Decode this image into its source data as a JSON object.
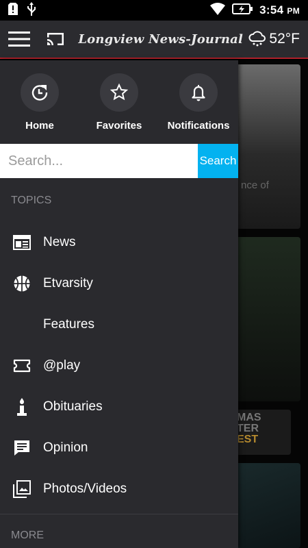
{
  "status_bar": {
    "time": "3:54",
    "ampm": "PM"
  },
  "app_bar": {
    "title": "Longview News-Journal",
    "temperature": "52°F",
    "icons": [
      "menu-icon",
      "cast-icon",
      "rain-cloud-icon"
    ]
  },
  "background": {
    "teaser": "nce of",
    "xmas_lines": [
      "MAS",
      "TER",
      "EST"
    ]
  },
  "drawer": {
    "quick_actions": [
      {
        "label": "Home",
        "icon": "refresh-home-icon"
      },
      {
        "label": "Favorites",
        "icon": "star-icon"
      },
      {
        "label": "Notifications",
        "icon": "bell-icon"
      }
    ],
    "search": {
      "placeholder": "Search...",
      "button": "Search"
    },
    "topics_header": "TOPICS",
    "topics": [
      {
        "label": "News",
        "icon": "newspaper-icon"
      },
      {
        "label": "Etvarsity",
        "icon": "basketball-icon"
      },
      {
        "label": "Features",
        "icon": ""
      },
      {
        "label": "@play",
        "icon": "ticket-icon"
      },
      {
        "label": "Obituaries",
        "icon": "candle-icon"
      },
      {
        "label": "Opinion",
        "icon": "comment-icon"
      },
      {
        "label": "Photos/Videos",
        "icon": "photo-library-icon"
      }
    ],
    "more_header": "MORE"
  },
  "colors": {
    "accent": "#03b2f0",
    "appbar": "#2b2b2f",
    "drawer": "#2a2a2e",
    "brand_line": "#b0202a"
  }
}
